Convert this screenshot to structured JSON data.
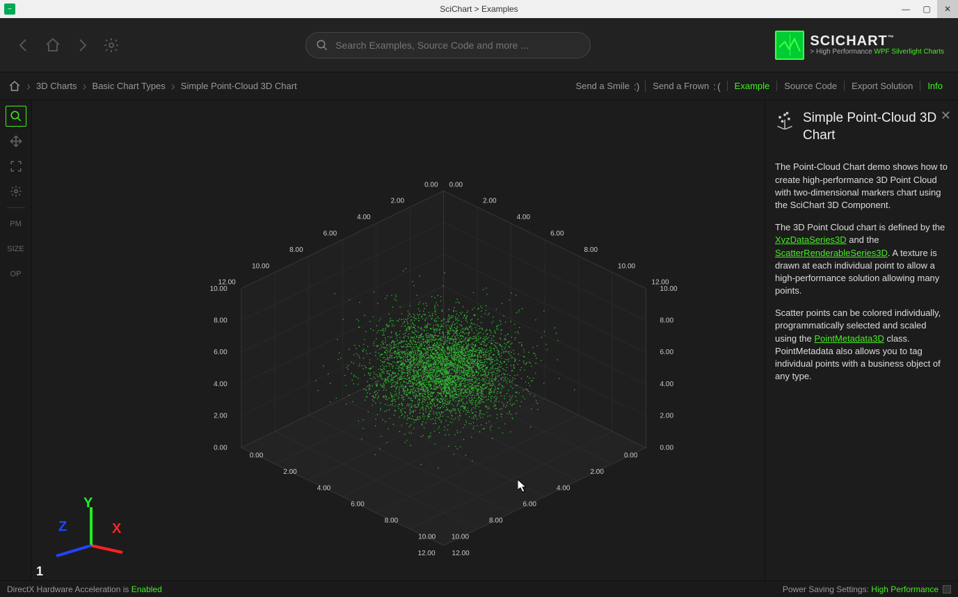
{
  "window": {
    "title": "SciChart > Examples"
  },
  "brand": {
    "name": "SCICHART",
    "tagline_prefix": "> High Performance ",
    "tagline_highlight": "WPF Silverlight Charts"
  },
  "search": {
    "placeholder": "Search Examples, Source Code and more ..."
  },
  "breadcrumb": {
    "l1": "3D Charts",
    "l2": "Basic Chart Types",
    "l3": "Simple Point-Cloud 3D Chart"
  },
  "actions": {
    "send_smile": "Send a Smile",
    "send_frown": "Send a Frown",
    "example": "Example",
    "source_code": "Source Code",
    "export_solution": "Export Solution",
    "info": "Info"
  },
  "left_tools": {
    "pm": "PM",
    "size": "SIZE",
    "op": "OP"
  },
  "info_panel": {
    "title": "Simple Point-Cloud 3D Chart",
    "p1": "The Point-Cloud Chart demo shows how to create high-performance 3D Point Cloud with two-dimensional markers chart using the SciChart 3D Component.",
    "p2a": "The 3D Point Cloud chart is defined by the ",
    "p2_link1": "XyzDataSeries3D",
    "p2b": " and the ",
    "p2_link2": "ScatterRenderableSeries3D",
    "p2c": ". A texture is drawn at each individual point to allow a high-performance solution allowing many points.",
    "p3a": "Scatter points can be colored individually, programmatically selected and scaled using the ",
    "p3_link1": "PointMetadata3D",
    "p3b": " class. PointMetadata also allows you to tag individual points with a business object of any type."
  },
  "gizmo": {
    "x": "X",
    "y": "Y",
    "z": "Z",
    "seq": "1"
  },
  "statusbar": {
    "accel_prefix": "DirectX Hardware Acceleration is ",
    "accel_state": "Enabled",
    "power_prefix": "Power Saving Settings: ",
    "power_state": "High Performance"
  },
  "chart_data": {
    "type": "scatter",
    "description": "3D point cloud, gaussian distribution centered ~ (5,5,5)",
    "point_count_estimate": 100000,
    "color": "#32cd32",
    "axes": {
      "x": {
        "min": 0,
        "max": 12,
        "ticks": [
          0,
          2,
          4,
          6,
          8,
          10,
          12
        ],
        "tick_labels": [
          "0.00",
          "2.00",
          "4.00",
          "6.00",
          "8.00",
          "10.00",
          "12.00"
        ]
      },
      "y": {
        "min": 0,
        "max": 10,
        "ticks": [
          0,
          2,
          4,
          6,
          8,
          10
        ],
        "tick_labels": [
          "0.00",
          "2.00",
          "4.00",
          "6.00",
          "8.00",
          "10.00"
        ]
      },
      "z": {
        "min": 0,
        "max": 12,
        "ticks": [
          0,
          2,
          4,
          6,
          8,
          10,
          12
        ],
        "tick_labels": [
          "0.00",
          "2.00",
          "4.00",
          "6.00",
          "8.00",
          "10.00",
          "12.00"
        ]
      }
    }
  }
}
